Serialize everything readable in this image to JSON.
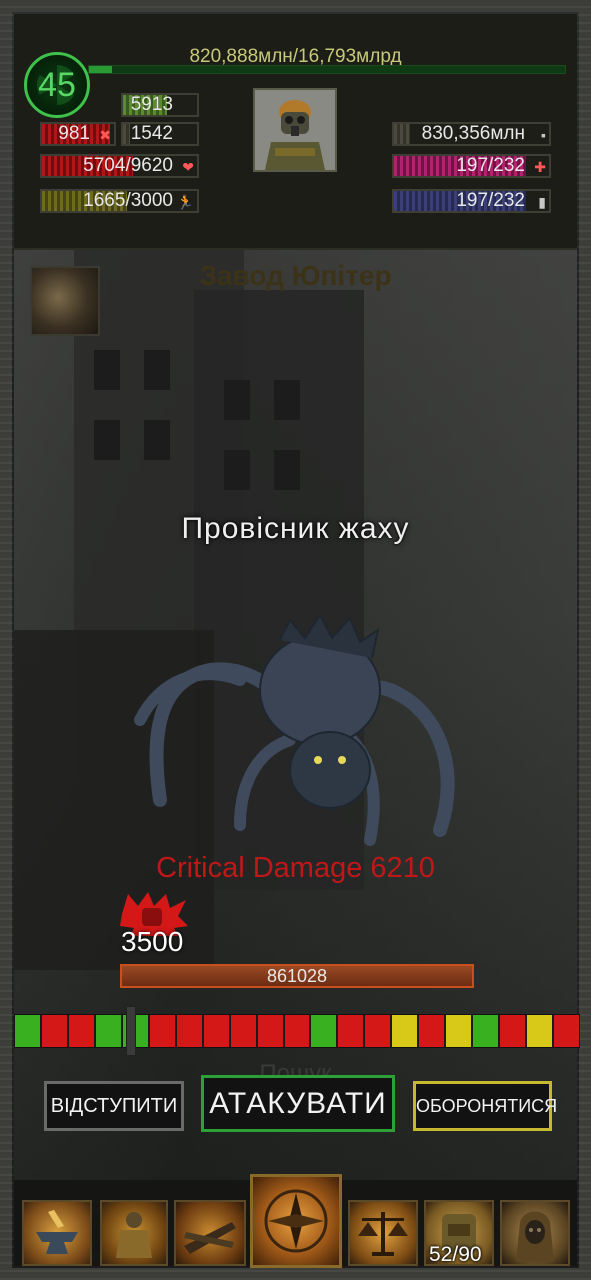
{
  "hud": {
    "level": "45",
    "xp_text": "820,888млн/16,793млрд",
    "xp_fraction": 0.049,
    "stats_left": [
      {
        "key": "stat-5913",
        "value": "5913",
        "color": "stripe-green",
        "icon": "",
        "fill": 0.6
      },
      {
        "key": "stat-981",
        "value": "981",
        "color": "stripe-red",
        "icon": "✖",
        "fill": 0.95
      },
      {
        "key": "stat-1542",
        "value": "1542",
        "color": "stripe-gray",
        "icon": "",
        "fill": 0.1
      },
      {
        "key": "health",
        "value": "5704/9620",
        "color": "stripe-red",
        "icon": "❤",
        "fill": 0.59
      },
      {
        "key": "stamina",
        "value": "1665/3000",
        "color": "stripe-olive",
        "icon": "🏃",
        "fill": 0.55
      }
    ],
    "stats_right": [
      {
        "key": "money",
        "value": "830,356млн",
        "color": "stripe-gray",
        "icon": "▪",
        "fill": 0.1
      },
      {
        "key": "radiation",
        "value": "197/232",
        "color": "stripe-magenta",
        "icon": "✚",
        "fill": 0.85
      },
      {
        "key": "ammo",
        "value": "197/232",
        "color": "stripe-blue",
        "icon": "▮",
        "fill": 0.85
      }
    ]
  },
  "location": {
    "name": "Завод Юпітер"
  },
  "enemy": {
    "name": "Провісник жаху",
    "critical_text": "Critical Damage 6210",
    "damage": "3500",
    "hp": "861028",
    "hp_fraction": 1.0
  },
  "timing_bar": {
    "segments": [
      "green",
      "red",
      "red",
      "green",
      "green",
      "red",
      "red",
      "red",
      "red",
      "red",
      "red",
      "green",
      "red",
      "red",
      "yellow",
      "red",
      "yellow",
      "green",
      "red",
      "yellow",
      "red"
    ],
    "colors": {
      "green": "#38b020",
      "red": "#d41818",
      "yellow": "#d8c818"
    }
  },
  "ghost_text": "Пошук",
  "actions": {
    "retreat": "ВІДСТУПИТИ",
    "attack": "АТАКУВАТИ",
    "defend": "ОБОРОНЯТИСЯ"
  },
  "nav": {
    "items": [
      {
        "name": "nav-anvil-icon"
      },
      {
        "name": "nav-armor-icon"
      },
      {
        "name": "nav-weapons-icon"
      },
      {
        "name": "nav-compass-icon"
      },
      {
        "name": "nav-scales-icon"
      },
      {
        "name": "nav-backpack-icon"
      },
      {
        "name": "nav-stalker-icon"
      }
    ],
    "inventory_count": "52/90"
  }
}
